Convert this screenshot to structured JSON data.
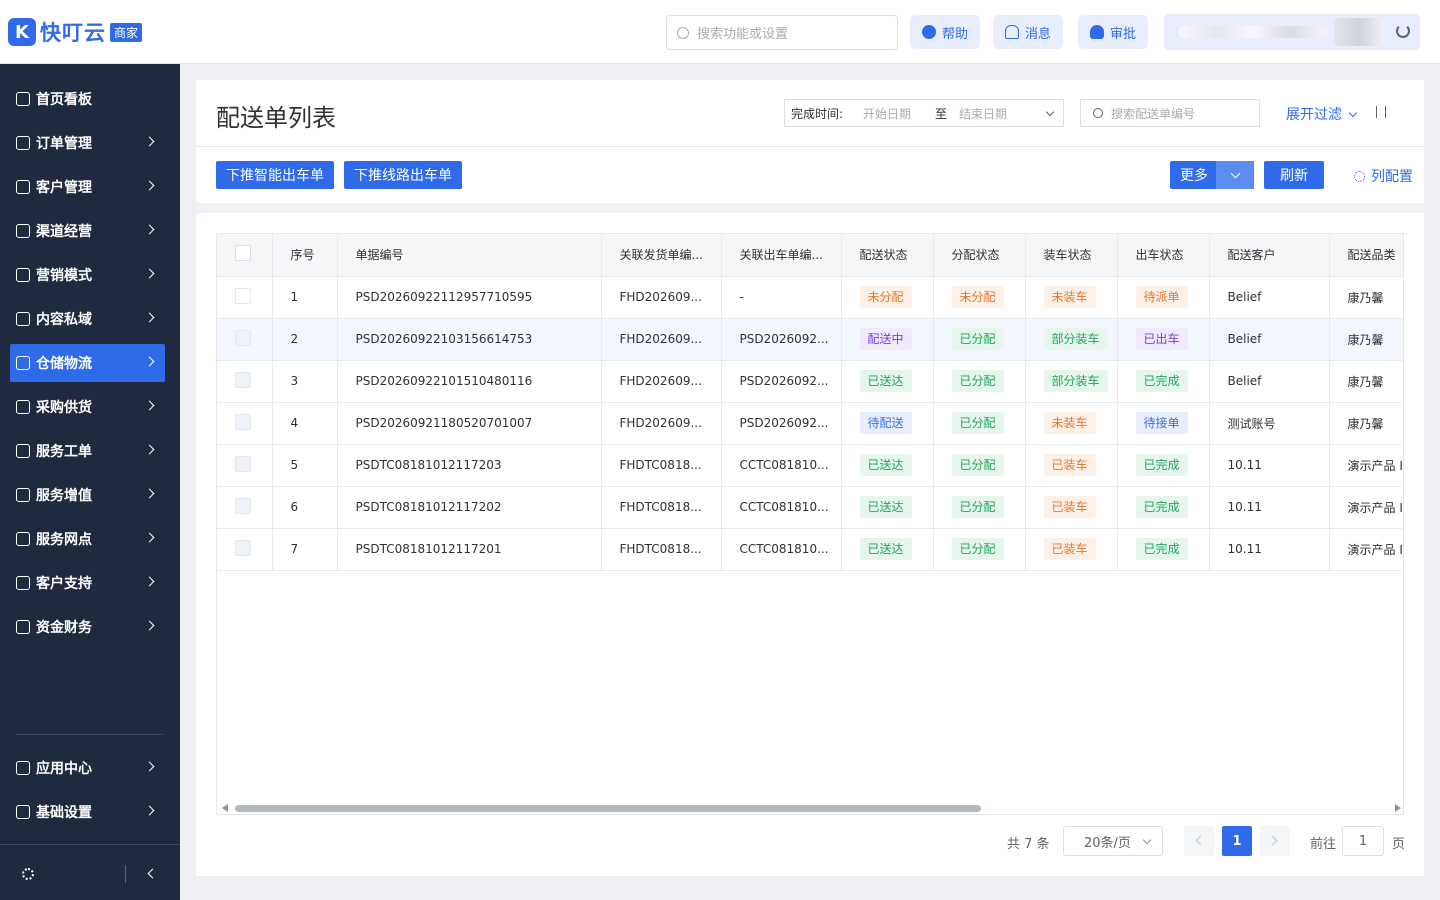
{
  "brand": {
    "logo_letter": "K",
    "name": "快叮云",
    "badge": "商家",
    "color": "#2f6be8"
  },
  "topbar": {
    "search_placeholder": "搜索功能或设置",
    "buttons": [
      {
        "label": "帮助",
        "icon": "help-icon"
      },
      {
        "label": "消息",
        "icon": "bell-icon"
      },
      {
        "label": "审批",
        "icon": "user-icon"
      }
    ]
  },
  "sidebar": {
    "items": [
      {
        "label": "首页看板",
        "icon": "home-icon",
        "chevron": false
      },
      {
        "label": "订单管理",
        "icon": "clipboard-icon",
        "chevron": true
      },
      {
        "label": "客户管理",
        "icon": "user-icon",
        "chevron": true
      },
      {
        "label": "渠道经营",
        "icon": "network-icon",
        "chevron": true
      },
      {
        "label": "营销模式",
        "icon": "tag-icon",
        "chevron": true
      },
      {
        "label": "内容私域",
        "icon": "mail-icon",
        "chevron": true
      },
      {
        "label": "仓储物流",
        "icon": "warehouse-icon",
        "chevron": true,
        "active": true
      },
      {
        "label": "采购供货",
        "icon": "person-icon",
        "chevron": true
      },
      {
        "label": "服务工单",
        "icon": "ticket-icon",
        "chevron": true
      },
      {
        "label": "服务增值",
        "icon": "bag-icon",
        "chevron": true
      },
      {
        "label": "服务网点",
        "icon": "store-icon",
        "chevron": true
      },
      {
        "label": "客户支持",
        "icon": "chat-icon",
        "chevron": true
      },
      {
        "label": "资金财务",
        "icon": "yen-icon",
        "chevron": true
      }
    ],
    "bottom_items": [
      {
        "label": "应用中心",
        "icon": "cube-icon"
      },
      {
        "label": "基础设置",
        "icon": "sliders-icon"
      }
    ]
  },
  "header": {
    "title": "配送单列表",
    "date_filter": {
      "label": "完成时间:",
      "start_placeholder": "开始日期",
      "separator": "至",
      "end_placeholder": "结束日期"
    },
    "search_placeholder": "搜索配送单编号",
    "expand_filter": "展开过滤",
    "actions": {
      "push_smart": "下推智能出车单",
      "push_route": "下推线路出车单",
      "more": "更多",
      "refresh": "刷新",
      "column_config": "列配置"
    }
  },
  "table": {
    "columns": [
      "序号",
      "单据编号",
      "关联发货单编...",
      "关联出车单编...",
      "配送状态",
      "分配状态",
      "装车状态",
      "出车状态",
      "配送客户",
      "配送品类"
    ],
    "rows": [
      {
        "no": "1",
        "code": "PSD20260922112957710595",
        "ship": "FHD202609...",
        "car": "-",
        "delivery": {
          "text": "未分配",
          "color": "orange"
        },
        "assign": {
          "text": "未分配",
          "color": "orange"
        },
        "load": {
          "text": "未装车",
          "color": "orange"
        },
        "depart": {
          "text": "待派单",
          "color": "orange"
        },
        "customer": "Belief",
        "category": "康乃馨"
      },
      {
        "no": "2",
        "code": "PSD20260922103156614753",
        "ship": "FHD202609...",
        "car": "PSD2026092...",
        "delivery": {
          "text": "配送中",
          "color": "purple"
        },
        "assign": {
          "text": "已分配",
          "color": "green"
        },
        "load": {
          "text": "部分装车",
          "color": "green"
        },
        "depart": {
          "text": "已出车",
          "color": "purple"
        },
        "customer": "Belief",
        "category": "康乃馨"
      },
      {
        "no": "3",
        "code": "PSD20260922101510480116",
        "ship": "FHD202609...",
        "car": "PSD2026092...",
        "delivery": {
          "text": "已送达",
          "color": "green"
        },
        "assign": {
          "text": "已分配",
          "color": "green"
        },
        "load": {
          "text": "部分装车",
          "color": "green"
        },
        "depart": {
          "text": "已完成",
          "color": "green"
        },
        "customer": "Belief",
        "category": "康乃馨"
      },
      {
        "no": "4",
        "code": "PSD20260921180520701007",
        "ship": "FHD202609...",
        "car": "PSD2026092...",
        "delivery": {
          "text": "待配送",
          "color": "blue"
        },
        "assign": {
          "text": "已分配",
          "color": "green"
        },
        "load": {
          "text": "未装车",
          "color": "orange"
        },
        "depart": {
          "text": "待接单",
          "color": "blue"
        },
        "customer": "测试账号",
        "category": "康乃馨"
      },
      {
        "no": "5",
        "code": "PSDTC08181012117203",
        "ship": "FHDTC0818...",
        "car": "CCTC081810...",
        "delivery": {
          "text": "已送达",
          "color": "green"
        },
        "assign": {
          "text": "已分配",
          "color": "green"
        },
        "load": {
          "text": "已装车",
          "color": "orange"
        },
        "depart": {
          "text": "已完成",
          "color": "green"
        },
        "customer": "10.11",
        "category": "演示产品 I"
      },
      {
        "no": "6",
        "code": "PSDTC08181012117202",
        "ship": "FHDTC0818...",
        "car": "CCTC081810...",
        "delivery": {
          "text": "已送达",
          "color": "green"
        },
        "assign": {
          "text": "已分配",
          "color": "green"
        },
        "load": {
          "text": "已装车",
          "color": "orange"
        },
        "depart": {
          "text": "已完成",
          "color": "green"
        },
        "customer": "10.11",
        "category": "演示产品 I"
      },
      {
        "no": "7",
        "code": "PSDTC08181012117201",
        "ship": "FHDTC0818...",
        "car": "CCTC081810...",
        "delivery": {
          "text": "已送达",
          "color": "green"
        },
        "assign": {
          "text": "已分配",
          "color": "green"
        },
        "load": {
          "text": "已装车",
          "color": "orange"
        },
        "depart": {
          "text": "已完成",
          "color": "green"
        },
        "customer": "10.11",
        "category": "演示产品 I"
      }
    ]
  },
  "pagination": {
    "total": "共 7 条",
    "page_size": "20条/页",
    "current": "1",
    "goto_label": "前往",
    "goto_value": "1",
    "page_suffix": "页"
  }
}
